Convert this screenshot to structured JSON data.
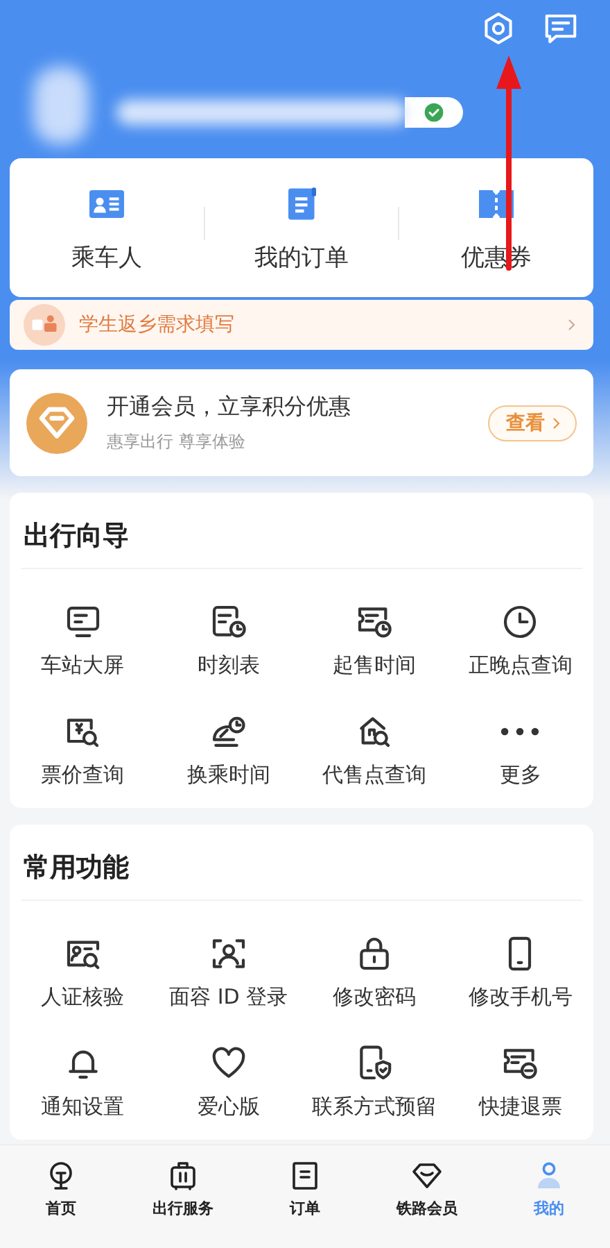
{
  "profile": {
    "verified": true
  },
  "quick_links": [
    {
      "label": "乘车人"
    },
    {
      "label": "我的订单"
    },
    {
      "label": "优惠券"
    }
  ],
  "banner": {
    "text": "学生返乡需求填写"
  },
  "membership": {
    "title": "开通会员，立享积分优惠",
    "subtitle": "惠享出行 尊享体验",
    "button": "查看"
  },
  "travel_guide": {
    "title": "出行向导",
    "items": [
      {
        "label": "车站大屏"
      },
      {
        "label": "时刻表"
      },
      {
        "label": "起售时间"
      },
      {
        "label": "正晚点查询"
      },
      {
        "label": "票价查询"
      },
      {
        "label": "换乘时间"
      },
      {
        "label": "代售点查询"
      },
      {
        "label": "更多"
      }
    ]
  },
  "common_functions": {
    "title": "常用功能",
    "items": [
      {
        "label": "人证核验"
      },
      {
        "label": "面容 ID 登录"
      },
      {
        "label": "修改密码"
      },
      {
        "label": "修改手机号"
      },
      {
        "label": "通知设置"
      },
      {
        "label": "爱心版"
      },
      {
        "label": "联系方式预留"
      },
      {
        "label": "快捷退票"
      }
    ]
  },
  "bottom_nav": [
    {
      "label": "首页",
      "selected": false
    },
    {
      "label": "出行服务",
      "selected": false
    },
    {
      "label": "订单",
      "selected": false
    },
    {
      "label": "铁路会员",
      "selected": false
    },
    {
      "label": "我的",
      "selected": true
    }
  ],
  "annotation": {
    "kind": "arrow"
  }
}
